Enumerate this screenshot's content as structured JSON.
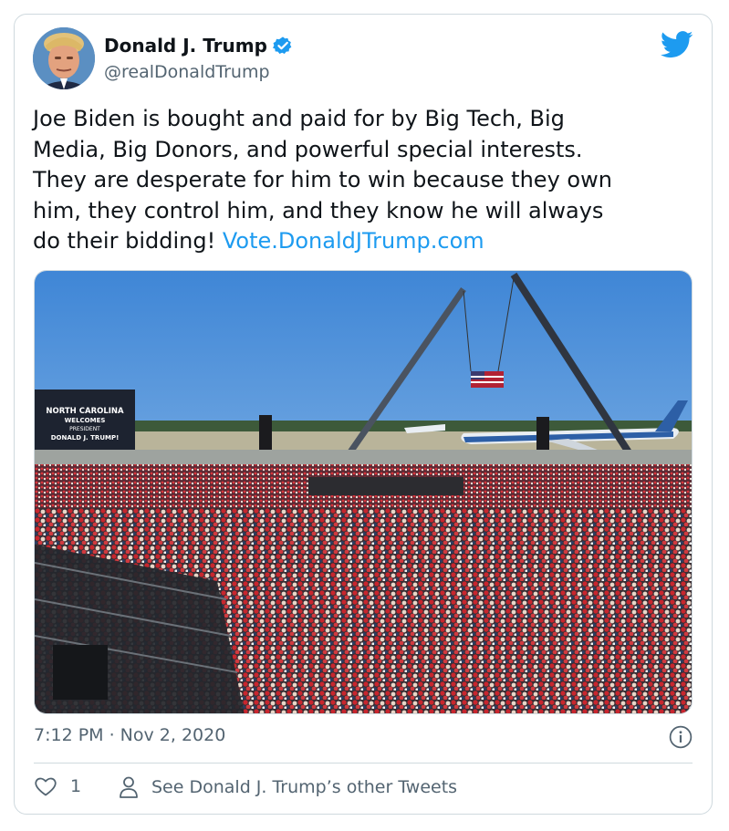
{
  "tweet": {
    "author_name": "Donald J. Trump",
    "author_handle": "@realDonaldTrump",
    "text": "Joe Biden is bought and paid for by Big Tech, Big\nMedia, Big Donors, and powerful special interests.\nThey are desperate for him to win because they own\nhim, they control him, and they know he will always\ndo their bidding! ",
    "link_text": "Vote.DonaldJTrump.com",
    "timestamp": "7:12 PM · Nov 2, 2020",
    "like_count": "1",
    "other_tweets_label": "See Donald J. Trump’s other Tweets"
  },
  "media": {
    "billboard_line1": "NORTH CAROLINA",
    "billboard_line2": "WELCOMES",
    "billboard_line3": "PRESIDENT",
    "billboard_line4": "DONALD J. TRUMP!"
  },
  "colors": {
    "link": "#1d9bf0",
    "verified": "#1d9bf0",
    "muted_text": "#536471",
    "border": "#cfd9de"
  },
  "icons": [
    "verified-badge-icon",
    "twitter-bird-icon",
    "info-icon",
    "heart-icon",
    "person-icon"
  ]
}
